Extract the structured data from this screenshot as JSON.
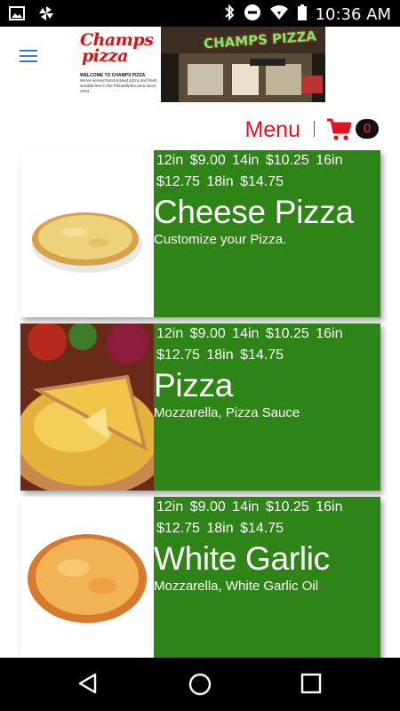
{
  "status_bar": {
    "time": "10:36 AM",
    "left_icons": [
      "image-icon",
      "pinwheel-icon"
    ],
    "right_icons": [
      "bluetooth-icon",
      "do-not-disturb-icon",
      "wifi-icon",
      "battery-icon"
    ]
  },
  "header": {
    "logo_line1": "Champs",
    "logo_line2": "pizza",
    "welcome_title": "WELCOME TO CHAMPS PIZZA",
    "welcome_text": "We've served hand-tossed pizza and fresh sandwiches in the Philadelphia area since 2004.",
    "store_sign": "CHAMPS PIZZA"
  },
  "menu_bar": {
    "label": "Menu",
    "cart_count": "0"
  },
  "items": [
    {
      "prices": "12in $9.00   14in $10.25   16in $12.75   18in $14.75",
      "name": "Cheese Pizza",
      "description": "Customize your Pizza."
    },
    {
      "prices": "12in $9.00   14in $10.25   16in $12.75   18in $14.75",
      "name": "Pizza",
      "description": "Mozzarella, Pizza Sauce"
    },
    {
      "prices": "12in $9.00   14in $10.25   16in $12.75   18in $14.75",
      "name": "White Garlic",
      "description": "Mozzarella, White Garlic Oil"
    }
  ],
  "colors": {
    "accent_red": "#e0141a",
    "item_green": "#2f8418",
    "hamburger_blue": "#3a7bd5"
  },
  "nav_bar": {
    "buttons": [
      "back-icon",
      "home-icon",
      "recents-icon"
    ]
  }
}
